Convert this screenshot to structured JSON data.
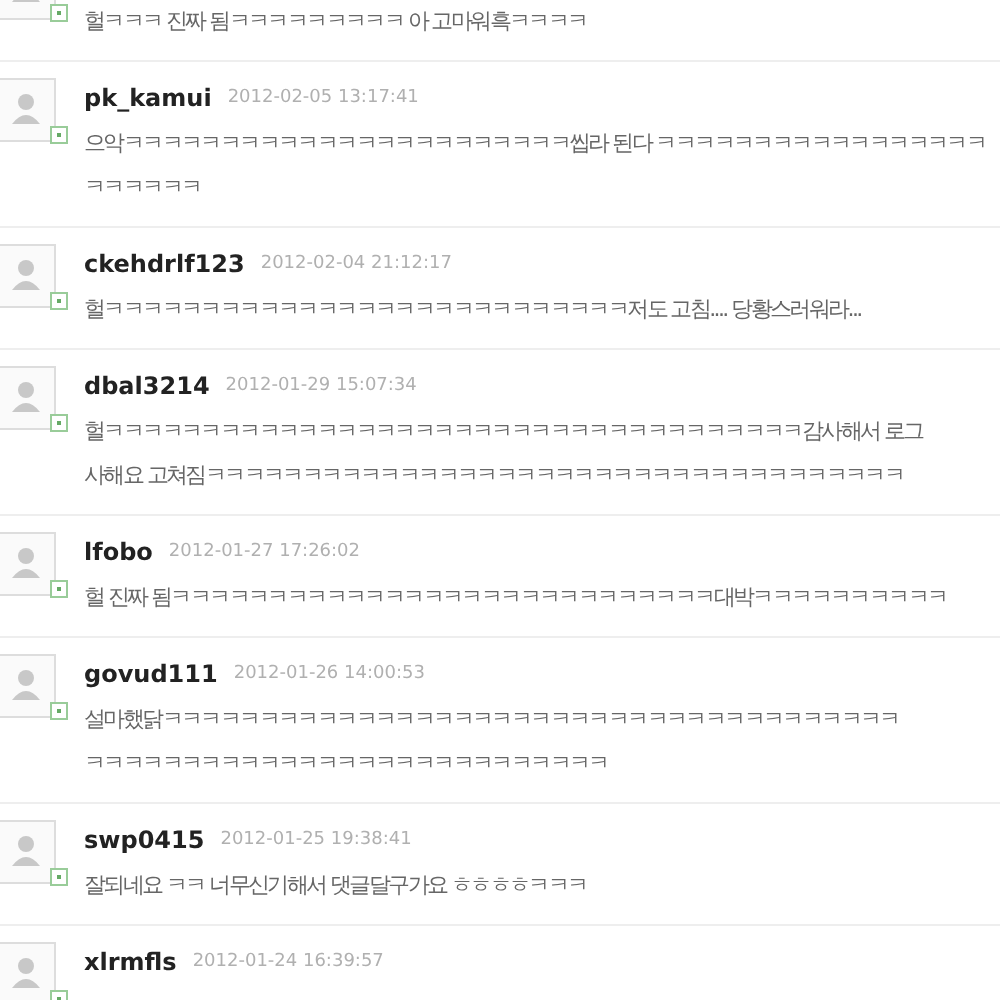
{
  "comments": [
    {
      "text_lines": [
        "헐ㅋㅋㅋ 진짜 됨ㅋㅋㅋㅋㅋㅋㅋㅋㅋ 아 고마워흑ㅋㅋㅋㅋ"
      ]
    },
    {
      "author": "pk_kamui",
      "date": "2012-02-05 13:17:41",
      "text_lines": [
        "으악ㅋㅋㅋㅋㅋㅋㅋㅋㅋㅋㅋㅋㅋㅋㅋㅋㅋㅋㅋㅋㅋㅋㅋ씹라 된다 ㅋㅋㅋㅋㅋㅋㅋㅋㅋㅋㅋㅋㅋㅋㅋㅋㅋ",
        "ㅋㅋㅋㅋㅋㅋ"
      ]
    },
    {
      "author": "ckehdrlf123",
      "date": "2012-02-04 21:12:17",
      "text_lines": [
        "헐ㅋㅋㅋㅋㅋㅋㅋㅋㅋㅋㅋㅋㅋㅋㅋㅋㅋㅋㅋㅋㅋㅋㅋㅋㅋㅋㅋ저도 고침.... 당황스러워라..."
      ]
    },
    {
      "author": "dbal3214",
      "date": "2012-01-29 15:07:34",
      "text_lines": [
        "헐ㅋㅋㅋㅋㅋㅋㅋㅋㅋㅋㅋㅋㅋㅋㅋㅋㅋㅋㅋㅋㅋㅋㅋㅋㅋㅋㅋㅋㅋㅋㅋㅋㅋㅋㅋㅋ감사해서 로그",
        "사해요 고쳐짐ㅋㅋㅋㅋㅋㅋㅋㅋㅋㅋㅋㅋㅋㅋㅋㅋㅋㅋㅋㅋㅋㅋㅋㅋㅋㅋㅋㅋㅋㅋㅋㅋㅋㅋㅋㅋ"
      ]
    },
    {
      "author": "lfobo",
      "date": "2012-01-27 17:26:02",
      "text_lines": [
        "헐 진짜 됨ㅋㅋㅋㅋㅋㅋㅋㅋㅋㅋㅋㅋㅋㅋㅋㅋㅋㅋㅋㅋㅋㅋㅋㅋㅋㅋㅋㅋ대박ㅋㅋㅋㅋㅋㅋㅋㅋㅋㅋ"
      ]
    },
    {
      "author": "govud111",
      "date": "2012-01-26 14:00:53",
      "text_lines": [
        "설마했닭ㅋㅋㅋㅋㅋㅋㅋㅋㅋㅋㅋㅋㅋㅋㅋㅋㅋㅋㅋㅋㅋㅋㅋㅋㅋㅋㅋㅋㅋㅋㅋㅋㅋㅋㅋㅋㅋㅋ",
        "ㅋㅋㅋㅋㅋㅋㅋㅋㅋㅋㅋㅋㅋㅋㅋㅋㅋㅋㅋㅋㅋㅋㅋㅋㅋㅋㅋ"
      ]
    },
    {
      "author": "swp0415",
      "date": "2012-01-25 19:38:41",
      "text_lines": [
        "잘되네요 ㅋㅋ 너무신기해서 댓글달구가요 ㅎㅎㅎㅎㅋㅋㅋ"
      ]
    },
    {
      "author": "xlrmfls",
      "date": "2012-01-24 16:39:57"
    }
  ]
}
